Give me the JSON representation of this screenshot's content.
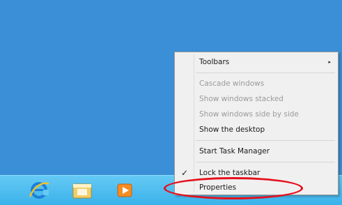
{
  "desktop": {
    "background": "#3a8fd6"
  },
  "taskbar": {
    "icons": [
      {
        "name": "internet-explorer-icon"
      },
      {
        "name": "file-explorer-icon"
      },
      {
        "name": "media-player-icon"
      }
    ]
  },
  "context_menu": {
    "items": [
      {
        "label": "Toolbars",
        "enabled": true,
        "submenu": true
      },
      {
        "label": "Cascade windows",
        "enabled": false
      },
      {
        "label": "Show windows stacked",
        "enabled": false
      },
      {
        "label": "Show windows side by side",
        "enabled": false
      },
      {
        "label": "Show the desktop",
        "enabled": true
      },
      {
        "label": "Start Task Manager",
        "enabled": true
      },
      {
        "label": "Lock the taskbar",
        "enabled": true,
        "checked": true,
        "check_glyph": "✓"
      },
      {
        "label": "Properties",
        "enabled": true
      }
    ],
    "submenu_glyph": "▸"
  },
  "annotation": {
    "color": "#e5101c"
  }
}
